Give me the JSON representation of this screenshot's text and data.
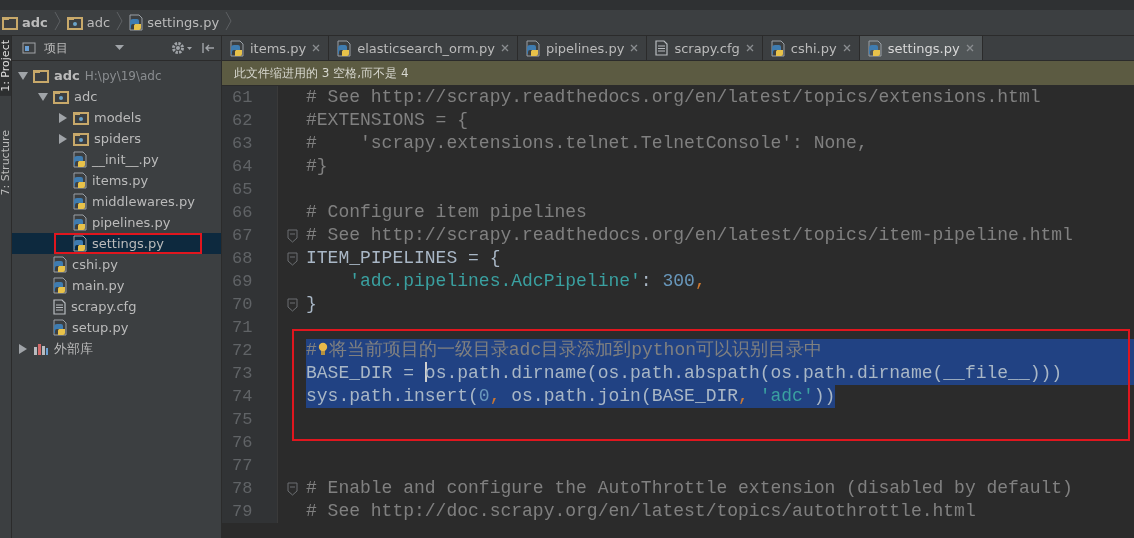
{
  "breadcrumb": [
    {
      "label": "adc",
      "kind": "project"
    },
    {
      "label": "adc",
      "kind": "package"
    },
    {
      "label": "settings.py",
      "kind": "python"
    }
  ],
  "side_strip": [
    {
      "label": "1: Project",
      "selected": true
    },
    {
      "label": "7: Structure",
      "selected": false
    }
  ],
  "project_panel": {
    "title": "项目",
    "tree": [
      {
        "label": "adc",
        "kind": "project",
        "hint": "H:\\py\\19\\adc",
        "expanded": true,
        "selected": false,
        "framed": false,
        "children": [
          {
            "label": "adc",
            "kind": "package",
            "expanded": true,
            "selected": false,
            "framed": false,
            "children": [
              {
                "label": "models",
                "kind": "package",
                "expanded": false,
                "selected": false,
                "framed": false
              },
              {
                "label": "spiders",
                "kind": "package",
                "expanded": false,
                "selected": false,
                "framed": false
              },
              {
                "label": "__init__.py",
                "kind": "python",
                "selected": false,
                "framed": false
              },
              {
                "label": "items.py",
                "kind": "python",
                "selected": false,
                "framed": false
              },
              {
                "label": "middlewares.py",
                "kind": "python",
                "selected": false,
                "framed": false
              },
              {
                "label": "pipelines.py",
                "kind": "python",
                "selected": false,
                "framed": false
              },
              {
                "label": "settings.py",
                "kind": "python",
                "selected": true,
                "framed": true
              }
            ]
          },
          {
            "label": "cshi.py",
            "kind": "python",
            "selected": false,
            "framed": false
          },
          {
            "label": "main.py",
            "kind": "python",
            "selected": false,
            "framed": false
          },
          {
            "label": "scrapy.cfg",
            "kind": "config",
            "selected": false,
            "framed": false
          },
          {
            "label": "setup.py",
            "kind": "python",
            "selected": false,
            "framed": false
          }
        ]
      },
      {
        "label": "外部库",
        "kind": "library",
        "expanded": false,
        "selected": false,
        "framed": false
      }
    ]
  },
  "tabs": [
    {
      "label": "items.py",
      "kind": "python",
      "selected": false
    },
    {
      "label": "elasticsearch_orm.py",
      "kind": "python",
      "selected": false
    },
    {
      "label": "pipelines.py",
      "kind": "python",
      "selected": false
    },
    {
      "label": "scrapy.cfg",
      "kind": "config",
      "selected": false
    },
    {
      "label": "cshi.py",
      "kind": "python",
      "selected": false
    },
    {
      "label": "settings.py",
      "kind": "python",
      "selected": true
    }
  ],
  "notification": "此文件缩进用的 3 空格,而不是 4",
  "editor": {
    "blocks": [
      {
        "framed": false,
        "lines": [
          {
            "number": "61",
            "fold": false,
            "selected": false,
            "tokens": [
              {
                "text": "# See http://scrapy.readthedocs.org/en/latest/topics/extensions.html",
                "kind": "comment"
              }
            ]
          },
          {
            "number": "62",
            "fold": false,
            "selected": false,
            "tokens": [
              {
                "text": "#EXTENSIONS = {",
                "kind": "comment"
              }
            ]
          },
          {
            "number": "63",
            "fold": false,
            "selected": false,
            "tokens": [
              {
                "text": "#    'scrapy.extensions.telnet.TelnetConsole': None,",
                "kind": "comment"
              }
            ]
          },
          {
            "number": "64",
            "fold": false,
            "selected": false,
            "tokens": [
              {
                "text": "#}",
                "kind": "comment"
              }
            ]
          },
          {
            "number": "65",
            "fold": false,
            "selected": false
          },
          {
            "number": "66",
            "fold": false,
            "selected": false,
            "tokens": [
              {
                "text": "# Configure item pipelines",
                "kind": "comment"
              }
            ]
          },
          {
            "number": "67",
            "fold": true,
            "selected": false,
            "tokens": [
              {
                "text": "# See http://scrapy.readthedocs.org/en/latest/topics/item-pipeline.html",
                "kind": "comment"
              }
            ]
          },
          {
            "number": "68",
            "fold": true,
            "selected": false,
            "tokens": [
              {
                "text": "ITEM_PIPELINES = {",
                "kind": "plain"
              }
            ]
          },
          {
            "number": "69",
            "fold": false,
            "selected": false,
            "tokens": [
              {
                "text": "    'adc.pipelines.AdcPipeline'",
                "kind": "string"
              },
              {
                "text": ": ",
                "kind": "plain"
              },
              {
                "text": "300",
                "kind": "number"
              },
              {
                "text": ",",
                "kind": "punct"
              }
            ]
          },
          {
            "number": "70",
            "fold": true,
            "selected": false,
            "tokens": [
              {
                "text": "}",
                "kind": "plain"
              }
            ]
          },
          {
            "number": "71",
            "fold": false,
            "selected": false
          }
        ]
      },
      {
        "framed": true,
        "lines": [
          {
            "number": "72",
            "fold": false,
            "selected": true,
            "tokens": [
              {
                "text": "#",
                "kind": "comment"
              },
              {
                "kind": "bulb"
              },
              {
                "text": "将当前项目的一级目录adc目录添加到python可以识别目录中",
                "kind": "comment"
              }
            ]
          },
          {
            "number": "73",
            "fold": false,
            "selected": true,
            "tokens": [
              {
                "text": "BASE_DIR = ",
                "kind": "plain"
              },
              {
                "kind": "caret"
              },
              {
                "text": "os.path.dirname(os.path.abspath(os.path.dirname(__file__)))",
                "kind": "plain"
              }
            ]
          },
          {
            "number": "74",
            "fold": false,
            "selected": true,
            "tokens": [
              {
                "text": "sys.path.insert(",
                "kind": "plain"
              },
              {
                "text": "0",
                "kind": "number"
              },
              {
                "text": ",",
                "kind": "punct"
              },
              {
                "text": " os.path.join(BASE_DIR",
                "kind": "plain"
              },
              {
                "text": ",",
                "kind": "punct"
              },
              {
                "text": " 'adc'",
                "kind": "string"
              },
              {
                "text": "))",
                "kind": "plain"
              }
            ]
          },
          {
            "number": "75",
            "fold": false,
            "selected": false
          }
        ]
      },
      {
        "framed": false,
        "lines": [
          {
            "number": "76",
            "fold": false,
            "selected": false
          },
          {
            "number": "77",
            "fold": false,
            "selected": false
          },
          {
            "number": "78",
            "fold": true,
            "selected": false,
            "tokens": [
              {
                "text": "# Enable and configure the AutoThrottle extension (disabled by default)",
                "kind": "comment"
              }
            ]
          },
          {
            "number": "79",
            "fold": false,
            "selected": false,
            "tokens": [
              {
                "text": "# See http://doc.scrapy.org/en/latest/topics/autothrottle.html",
                "kind": "comment"
              }
            ]
          }
        ]
      }
    ]
  }
}
